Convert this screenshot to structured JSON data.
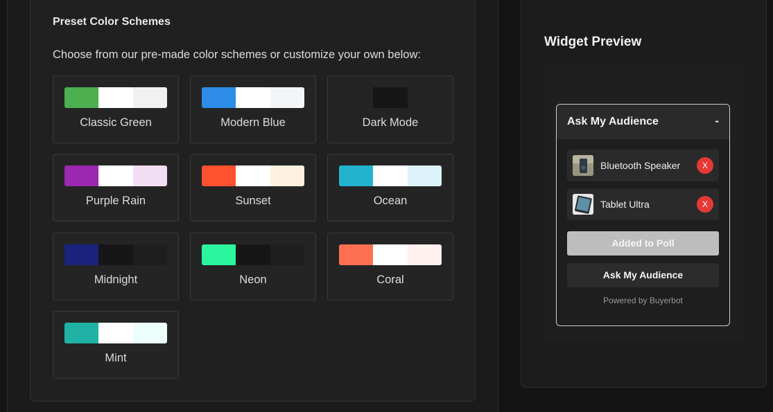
{
  "presets": {
    "title": "Preset Color Schemes",
    "description": "Choose from our pre-made color schemes or customize your own below:",
    "schemes": [
      {
        "name": "Classic Green",
        "colors": [
          "#4caf50",
          "#ffffff",
          "#f1f1f1"
        ]
      },
      {
        "name": "Modern Blue",
        "colors": [
          "#2d8ce8",
          "#ffffff",
          "#f4f5f7"
        ]
      },
      {
        "name": "Dark Mode",
        "colors": [
          "#242424",
          "#161616",
          "#242424"
        ]
      },
      {
        "name": "Purple Rain",
        "colors": [
          "#9c27b0",
          "#ffffff",
          "#f2def2"
        ]
      },
      {
        "name": "Sunset",
        "colors": [
          "#ff5030",
          "#ffffff",
          "#fff0e0"
        ]
      },
      {
        "name": "Ocean",
        "colors": [
          "#22b3cf",
          "#ffffff",
          "#dbf3f8"
        ]
      },
      {
        "name": "Midnight",
        "colors": [
          "#1a237e",
          "#161616",
          "#1e1e1e"
        ]
      },
      {
        "name": "Neon",
        "colors": [
          "#2bf59e",
          "#161616",
          "#1e1e1e"
        ]
      },
      {
        "name": "Coral",
        "colors": [
          "#ff7050",
          "#ffffff",
          "#fff1ef"
        ]
      },
      {
        "name": "Mint",
        "colors": [
          "#20b2a4",
          "#ffffff",
          "#edfffd"
        ]
      }
    ]
  },
  "preview": {
    "title": "Widget Preview",
    "widget": {
      "title": "Ask My Audience",
      "minimize_label": "-",
      "items": [
        {
          "name": "Bluetooth Speaker",
          "icon": "speaker-thumbnail",
          "remove_label": "X"
        },
        {
          "name": "Tablet Ultra",
          "icon": "tablet-thumbnail",
          "remove_label": "X"
        }
      ],
      "added_button": "Added to Poll",
      "ask_button": "Ask My Audience",
      "powered_by": "Powered by Buyerbot"
    }
  }
}
